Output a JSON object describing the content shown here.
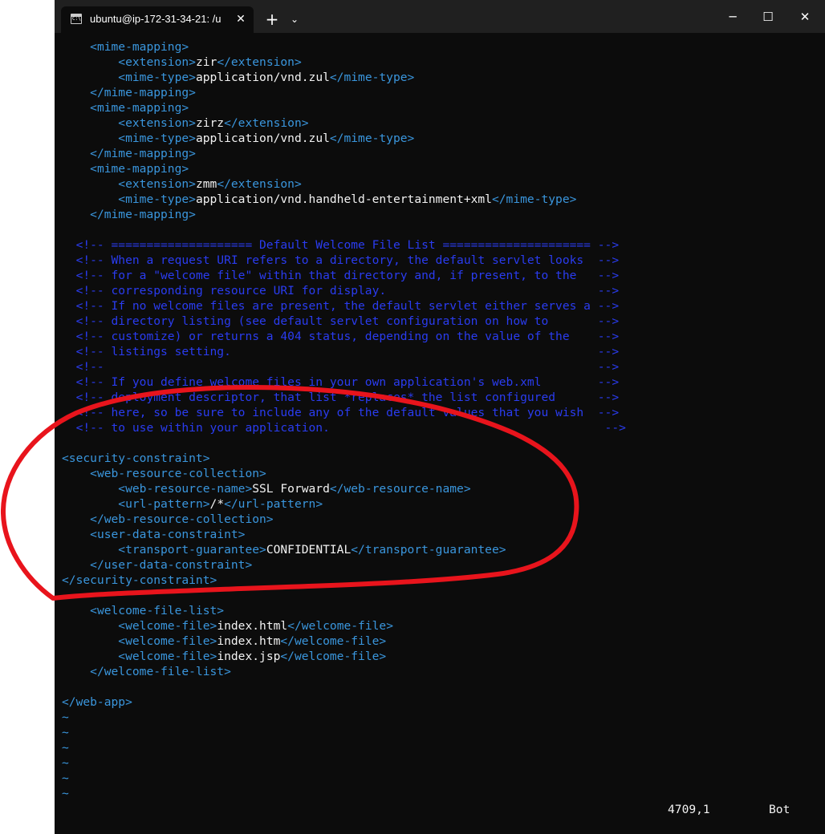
{
  "window": {
    "tab_title": "ubuntu@ip-172-31-34-21: /u",
    "close_tab_symbol": "✕",
    "new_tab_symbol": "+",
    "dropdown_symbol": "⌄",
    "minimize_symbol": "─",
    "maximize_symbol": "☐",
    "close_symbol": "✕"
  },
  "terminal": {
    "lines": [
      {
        "indent": "    ",
        "parts": [
          {
            "t": "<mime-mapping>",
            "c": "tag"
          }
        ]
      },
      {
        "indent": "        ",
        "parts": [
          {
            "t": "<extension>",
            "c": "tag"
          },
          {
            "t": "zir",
            "c": "val"
          },
          {
            "t": "</extension>",
            "c": "tag"
          }
        ]
      },
      {
        "indent": "        ",
        "parts": [
          {
            "t": "<mime-type>",
            "c": "tag"
          },
          {
            "t": "application/vnd.zul",
            "c": "val"
          },
          {
            "t": "</mime-type>",
            "c": "tag"
          }
        ]
      },
      {
        "indent": "    ",
        "parts": [
          {
            "t": "</mime-mapping>",
            "c": "tag"
          }
        ]
      },
      {
        "indent": "    ",
        "parts": [
          {
            "t": "<mime-mapping>",
            "c": "tag"
          }
        ]
      },
      {
        "indent": "        ",
        "parts": [
          {
            "t": "<extension>",
            "c": "tag"
          },
          {
            "t": "zirz",
            "c": "val"
          },
          {
            "t": "</extension>",
            "c": "tag"
          }
        ]
      },
      {
        "indent": "        ",
        "parts": [
          {
            "t": "<mime-type>",
            "c": "tag"
          },
          {
            "t": "application/vnd.zul",
            "c": "val"
          },
          {
            "t": "</mime-type>",
            "c": "tag"
          }
        ]
      },
      {
        "indent": "    ",
        "parts": [
          {
            "t": "</mime-mapping>",
            "c": "tag"
          }
        ]
      },
      {
        "indent": "    ",
        "parts": [
          {
            "t": "<mime-mapping>",
            "c": "tag"
          }
        ]
      },
      {
        "indent": "        ",
        "parts": [
          {
            "t": "<extension>",
            "c": "tag"
          },
          {
            "t": "zmm",
            "c": "val"
          },
          {
            "t": "</extension>",
            "c": "tag"
          }
        ]
      },
      {
        "indent": "        ",
        "parts": [
          {
            "t": "<mime-type>",
            "c": "tag"
          },
          {
            "t": "application/vnd.handheld-entertainment+xml",
            "c": "val"
          },
          {
            "t": "</mime-type>",
            "c": "tag"
          }
        ]
      },
      {
        "indent": "    ",
        "parts": [
          {
            "t": "</mime-mapping>",
            "c": "tag"
          }
        ]
      },
      {
        "indent": "",
        "parts": []
      },
      {
        "indent": "  ",
        "parts": [
          {
            "t": "<!-- ==================== Default Welcome File List ===================== -->",
            "c": "cmt"
          }
        ]
      },
      {
        "indent": "  ",
        "parts": [
          {
            "t": "<!-- When a request URI refers to a directory, the default servlet looks  -->",
            "c": "cmt"
          }
        ]
      },
      {
        "indent": "  ",
        "parts": [
          {
            "t": "<!-- for a \"welcome file\" within that directory and, if present, to the   -->",
            "c": "cmt"
          }
        ]
      },
      {
        "indent": "  ",
        "parts": [
          {
            "t": "<!-- corresponding resource URI for display.                              -->",
            "c": "cmt"
          }
        ]
      },
      {
        "indent": "  ",
        "parts": [
          {
            "t": "<!-- If no welcome files are present, the default servlet either serves a -->",
            "c": "cmt"
          }
        ]
      },
      {
        "indent": "  ",
        "parts": [
          {
            "t": "<!-- directory listing (see default servlet configuration on how to       -->",
            "c": "cmt"
          }
        ]
      },
      {
        "indent": "  ",
        "parts": [
          {
            "t": "<!-- customize) or returns a 404 status, depending on the value of the    -->",
            "c": "cmt"
          }
        ]
      },
      {
        "indent": "  ",
        "parts": [
          {
            "t": "<!-- listings setting.                                                    -->",
            "c": "cmt"
          }
        ]
      },
      {
        "indent": "  ",
        "parts": [
          {
            "t": "<!--                                                                      -->",
            "c": "cmt"
          }
        ]
      },
      {
        "indent": "  ",
        "parts": [
          {
            "t": "<!-- If you define welcome files in your own application's web.xml        -->",
            "c": "cmt"
          }
        ]
      },
      {
        "indent": "  ",
        "parts": [
          {
            "t": "<!-- deployment descriptor, that list *replaces* the list configured      -->",
            "c": "cmt"
          }
        ]
      },
      {
        "indent": "  ",
        "parts": [
          {
            "t": "<!-- here, so be sure to include any of the default values that you wish  -->",
            "c": "cmt"
          }
        ]
      },
      {
        "indent": "  ",
        "parts": [
          {
            "t": "<!-- to use within your application.                                       -->",
            "c": "cmt"
          }
        ]
      },
      {
        "indent": "",
        "parts": []
      },
      {
        "indent": "",
        "parts": [
          {
            "t": "<security-constraint>",
            "c": "tag"
          }
        ]
      },
      {
        "indent": "    ",
        "parts": [
          {
            "t": "<web-resource-collection>",
            "c": "tag"
          }
        ]
      },
      {
        "indent": "        ",
        "parts": [
          {
            "t": "<web-resource-name>",
            "c": "tag"
          },
          {
            "t": "SSL Forward",
            "c": "val"
          },
          {
            "t": "</web-resource-name>",
            "c": "tag"
          }
        ]
      },
      {
        "indent": "        ",
        "parts": [
          {
            "t": "<url-pattern>",
            "c": "tag"
          },
          {
            "t": "/*",
            "c": "val"
          },
          {
            "t": "</url-pattern>",
            "c": "tag"
          }
        ]
      },
      {
        "indent": "    ",
        "parts": [
          {
            "t": "</web-resource-collection>",
            "c": "tag"
          }
        ]
      },
      {
        "indent": "    ",
        "parts": [
          {
            "t": "<user-data-constraint>",
            "c": "tag"
          }
        ]
      },
      {
        "indent": "        ",
        "parts": [
          {
            "t": "<transport-guarantee>",
            "c": "tag"
          },
          {
            "t": "CONFIDENTIAL",
            "c": "val"
          },
          {
            "t": "</transport-guarantee>",
            "c": "tag"
          }
        ]
      },
      {
        "indent": "    ",
        "parts": [
          {
            "t": "</user-data-constraint>",
            "c": "tag"
          }
        ]
      },
      {
        "indent": "",
        "parts": [
          {
            "t": "</security-constraint>",
            "c": "tag"
          }
        ]
      },
      {
        "indent": "",
        "parts": []
      },
      {
        "indent": "    ",
        "parts": [
          {
            "t": "<welcome-file-list>",
            "c": "tag"
          }
        ]
      },
      {
        "indent": "        ",
        "parts": [
          {
            "t": "<welcome-file>",
            "c": "tag"
          },
          {
            "t": "index.html",
            "c": "val"
          },
          {
            "t": "</welcome-file>",
            "c": "tag"
          }
        ]
      },
      {
        "indent": "        ",
        "parts": [
          {
            "t": "<welcome-file>",
            "c": "tag"
          },
          {
            "t": "index.htm",
            "c": "val"
          },
          {
            "t": "</welcome-file>",
            "c": "tag"
          }
        ]
      },
      {
        "indent": "        ",
        "parts": [
          {
            "t": "<welcome-file>",
            "c": "tag"
          },
          {
            "t": "index.jsp",
            "c": "val"
          },
          {
            "t": "</welcome-file>",
            "c": "tag"
          }
        ]
      },
      {
        "indent": "    ",
        "parts": [
          {
            "t": "</welcome-file-list>",
            "c": "tag"
          }
        ]
      },
      {
        "indent": "",
        "parts": []
      },
      {
        "indent": "",
        "parts": [
          {
            "t": "</web-app>",
            "c": "tag"
          }
        ]
      },
      {
        "indent": "",
        "parts": [
          {
            "t": "~",
            "c": "tilde"
          }
        ]
      },
      {
        "indent": "",
        "parts": [
          {
            "t": "~",
            "c": "tilde"
          }
        ]
      },
      {
        "indent": "",
        "parts": [
          {
            "t": "~",
            "c": "tilde"
          }
        ]
      },
      {
        "indent": "",
        "parts": [
          {
            "t": "~",
            "c": "tilde"
          }
        ]
      },
      {
        "indent": "",
        "parts": [
          {
            "t": "~",
            "c": "tilde"
          }
        ]
      },
      {
        "indent": "",
        "parts": [
          {
            "t": "~",
            "c": "tilde"
          }
        ]
      }
    ],
    "status": {
      "position": "4709,1",
      "scroll": "Bot"
    }
  },
  "colors": {
    "tag": "#3a96dd",
    "value": "#f2f2f2",
    "comment": "#2a3cf0",
    "background": "#0c0c0c",
    "annotation": "#e8141c"
  }
}
